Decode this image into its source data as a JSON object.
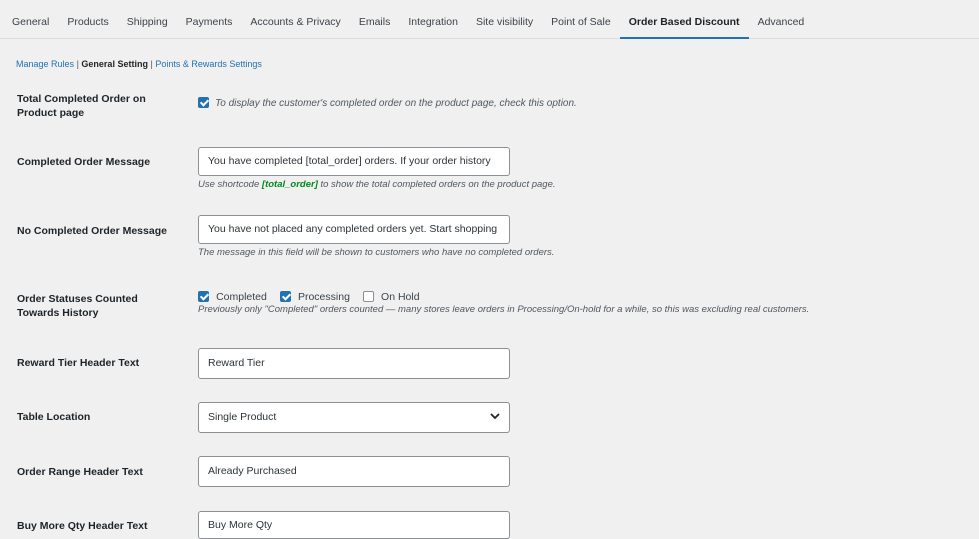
{
  "tabs": [
    "General",
    "Products",
    "Shipping",
    "Payments",
    "Accounts & Privacy",
    "Emails",
    "Integration",
    "Site visibility",
    "Point of Sale",
    "Order Based Discount",
    "Advanced"
  ],
  "active_tab": "Order Based Discount",
  "subnav": {
    "manage_rules": "Manage Rules",
    "separator": "|",
    "general_setting": "General Setting",
    "points_rewards": "Points & Rewards Settings"
  },
  "settings": {
    "total_completed": {
      "label": "Total Completed Order on Product page",
      "checked": true,
      "text": "To display the customer's completed order on the product page, check this option."
    },
    "completed_msg": {
      "label": "Completed Order Message",
      "value": "You have completed [total_order] orders. If your order history",
      "desc_pre": "Use shortcode",
      "desc_code": "[total_order]",
      "desc_post": "to show the total completed orders on the product page."
    },
    "no_completed_msg": {
      "label": "No Completed Order Message",
      "value": "You have not placed any completed orders yet. Start shopping",
      "desc": "The message in this field will be shown to customers who have no completed orders."
    },
    "order_statuses": {
      "label": "Order Statuses Counted Towards History",
      "options": [
        {
          "label": "Completed",
          "checked": true
        },
        {
          "label": "Processing",
          "checked": true
        },
        {
          "label": "On Hold",
          "checked": false
        }
      ],
      "desc": "Previously only \"Completed\" orders counted — many stores leave orders in Processing/On-hold for a while, so this was excluding real customers."
    },
    "reward_tier": {
      "label": "Reward Tier Header Text",
      "value": "Reward Tier"
    },
    "table_location": {
      "label": "Table Location",
      "value": "Single Product"
    },
    "order_range": {
      "label": "Order Range Header Text",
      "value": "Already Purchased"
    },
    "buy_more": {
      "label": "Buy More Qty Header Text",
      "value": "Buy More Qty"
    }
  },
  "colors": {
    "accent": "#2271b1",
    "shortcode": "#008a20",
    "background": "#f0f0f1"
  }
}
